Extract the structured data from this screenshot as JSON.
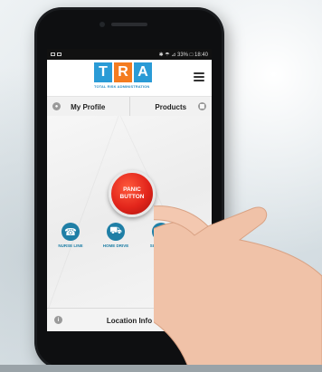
{
  "status_bar": {
    "left_icons": [
      "sim-icon",
      "chat-icon"
    ],
    "right_text": "✱ ☂ ⊿ 33% □ 18:40"
  },
  "header": {
    "logo_letters": [
      "T",
      "R",
      "A"
    ],
    "logo_colors": [
      "#2a9bd6",
      "#f47c20",
      "#2a9bd6"
    ],
    "tagline": "TOTAL RISK ADMINISTRATION",
    "menu_icon": "hamburger-icon"
  },
  "tabs": [
    {
      "label": "My Profile",
      "icon": "user-icon"
    },
    {
      "label": "Products",
      "icon": "grid-icon"
    }
  ],
  "panic_button": {
    "line1": "PANIC",
    "line2": "BUTTON"
  },
  "actions": [
    {
      "label": "NURSE LINE",
      "icon": "phone-icon"
    },
    {
      "label": "HOME DRIVE",
      "icon": "car-icon"
    },
    {
      "label": "SUBMIT CL",
      "icon": "clipboard-icon"
    }
  ],
  "bottom_bar": {
    "label": "Location Info",
    "icon": "info-icon"
  },
  "colors": {
    "accent_blue": "#1f7fa6",
    "panic_red": "#e2251b"
  }
}
